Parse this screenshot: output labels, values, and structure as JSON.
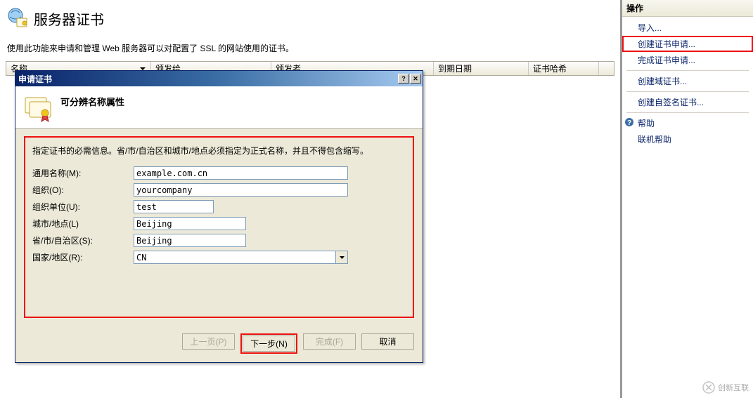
{
  "header": {
    "title": "服务器证书",
    "description": "使用此功能来申请和管理 Web 服务器可以对配置了 SSL 的网站使用的证书。"
  },
  "table": {
    "columns": {
      "name": "名称",
      "issuedTo": "颁发给",
      "issuer": "颁发者",
      "expires": "到期日期",
      "hash": "证书哈希"
    }
  },
  "dialog": {
    "title": "申请证书",
    "subtitle": "可分辨名称属性",
    "instruction": "指定证书的必需信息。省/市/自治区和城市/地点必须指定为正式名称，并且不得包含缩写。",
    "labels": {
      "commonName": "通用名称(M):",
      "organization": "组织(O):",
      "orgUnit": "组织单位(U):",
      "city": "城市/地点(L)",
      "state": "省/市/自治区(S):",
      "country": "国家/地区(R):"
    },
    "values": {
      "commonName": "example.com.cn",
      "organization": "yourcompany",
      "orgUnit": "test",
      "city": "Beijing",
      "state": "Beijing",
      "country": "CN"
    },
    "buttons": {
      "prev": "上一页(P)",
      "next": "下一步(N)",
      "finish": "完成(F)",
      "cancel": "取消"
    }
  },
  "actions": {
    "title": "操作",
    "items": {
      "import": "导入...",
      "createRequest": "创建证书申请...",
      "completeRequest": "完成证书申请...",
      "createDomain": "创建域证书...",
      "createSelfSigned": "创建自签名证书...",
      "help": "帮助",
      "onlineHelp": "联机帮助"
    }
  },
  "watermark": "创新互联"
}
